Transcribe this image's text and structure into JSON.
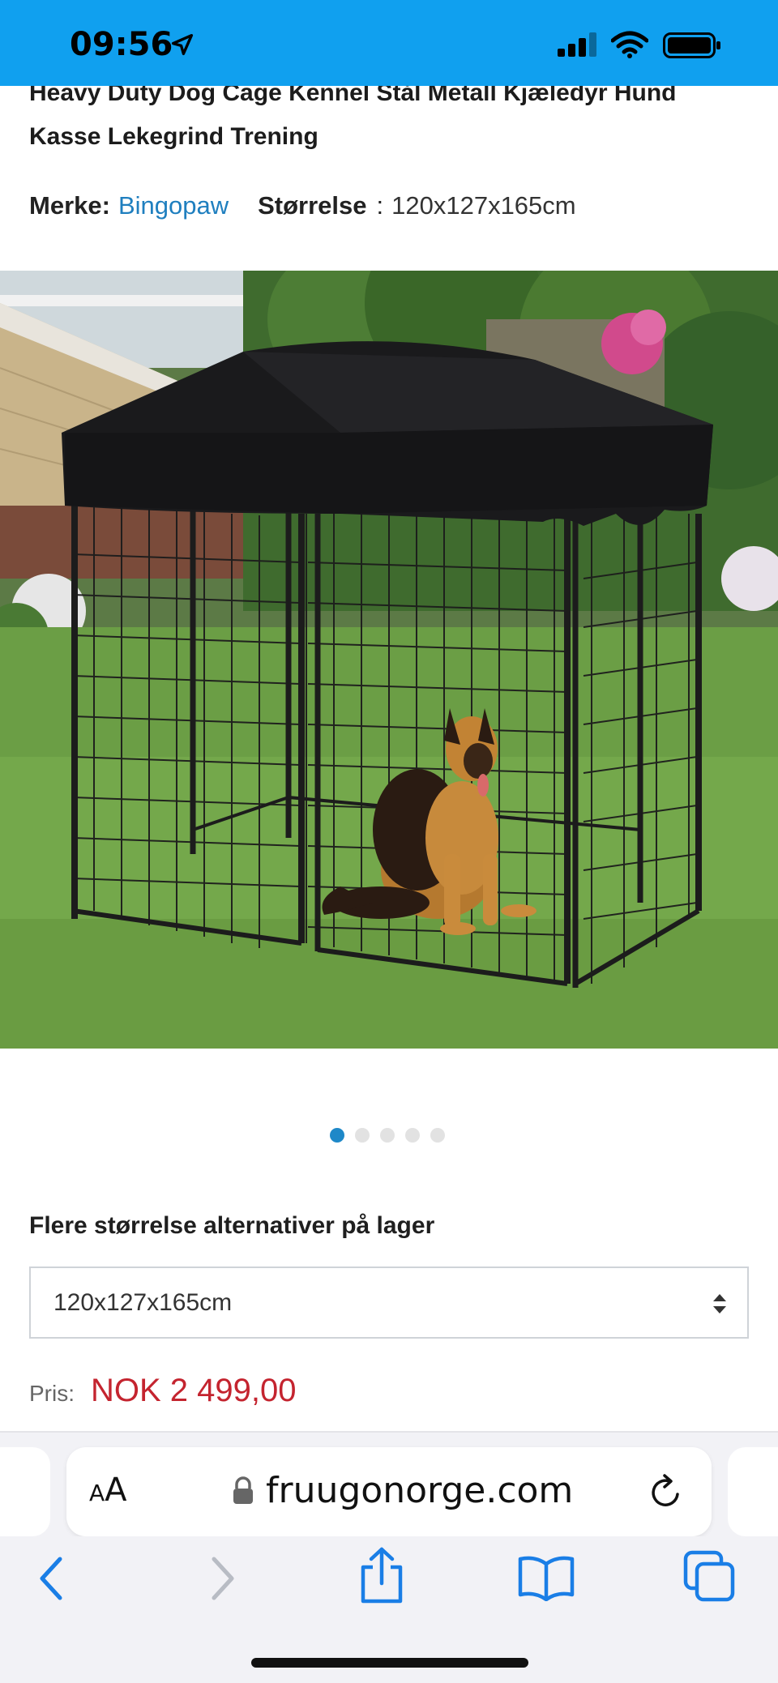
{
  "status_bar": {
    "time": "09:56",
    "background_color": "#10a0ef"
  },
  "product": {
    "title": "Heavy Duty Dog Cage Kennel Stål Metall Kjæledyr Hund Kasse Lekegrind Trening",
    "brand_label": "Merke:",
    "brand": "Bingopaw",
    "size_label": "Størrelse",
    "size_separator": ":",
    "size": "120x127x165cm",
    "image": {
      "icon": "dog-kennel-photo",
      "carousel_total": 5,
      "carousel_active_index": 0
    }
  },
  "options": {
    "heading": "Flere størrelse alternativer på lager",
    "selected": "120x127x165cm"
  },
  "price": {
    "label": "Pris:",
    "value": "NOK 2 499,00",
    "color": "#c4242f"
  },
  "browser": {
    "aa_small": "A",
    "aa_large": "A",
    "url": "fruugonorge.com",
    "accent_color": "#1a7ee6"
  }
}
